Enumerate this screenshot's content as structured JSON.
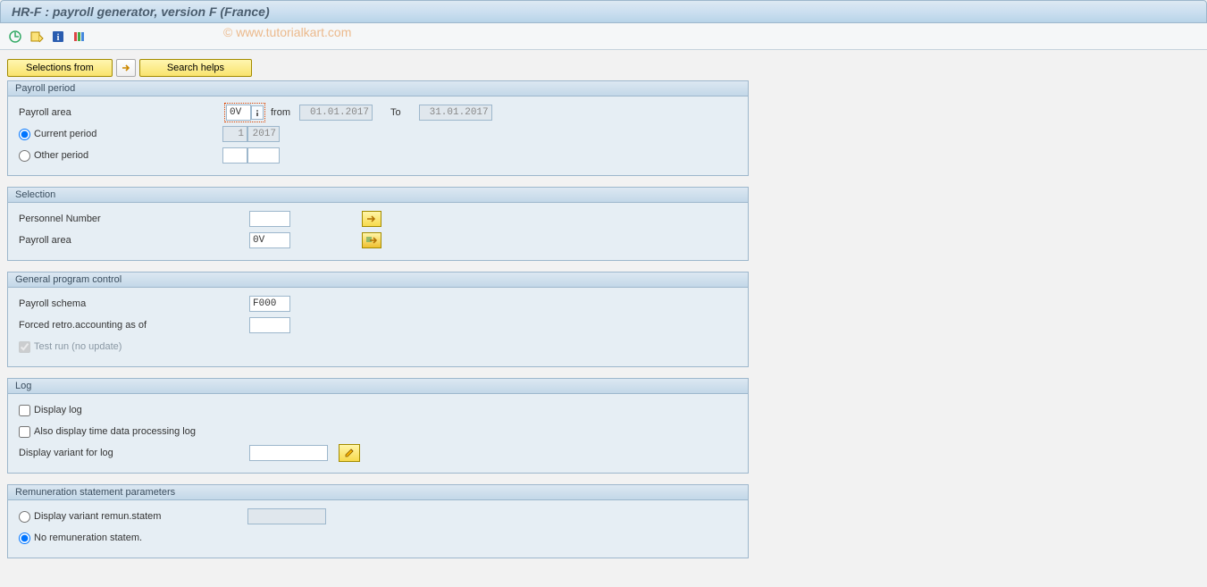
{
  "title": "HR-F : payroll generator, version F (France)",
  "watermark": "© www.tutorialkart.com",
  "buttons": {
    "selections_from": "Selections from",
    "search_helps": "Search helps"
  },
  "panels": {
    "payroll_period": {
      "title": "Payroll period",
      "payroll_area_label": "Payroll area",
      "payroll_area_value": "0V",
      "from_label": "from",
      "from_value": "01.01.2017",
      "to_label": "To",
      "to_value": "31.01.2017",
      "current_period_label": "Current period",
      "current_period_num": "1",
      "current_period_year": "2017",
      "other_period_label": "Other period"
    },
    "selection": {
      "title": "Selection",
      "personnel_number_label": "Personnel Number",
      "personnel_number_value": "",
      "payroll_area_label": "Payroll area",
      "payroll_area_value": "0V"
    },
    "general": {
      "title": "General program control",
      "schema_label": "Payroll schema",
      "schema_value": "F000",
      "forced_retro_label": "Forced retro.accounting as of",
      "forced_retro_value": "",
      "test_run_label": "Test run (no update)"
    },
    "log": {
      "title": "Log",
      "display_log_label": "Display log",
      "also_display_label": "Also display time data processing log",
      "variant_label": "Display variant for log",
      "variant_value": ""
    },
    "remun": {
      "title": "Remuneration statement parameters",
      "display_variant_label": "Display variant remun.statem",
      "display_variant_value": "",
      "no_remun_label": "No remuneration statem."
    }
  }
}
